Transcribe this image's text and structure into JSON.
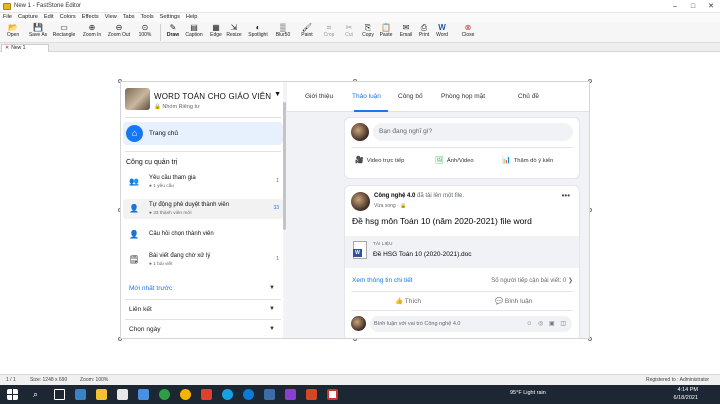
{
  "window": {
    "title": "New 1 - FastStone Editor",
    "controls": {
      "minimize": "–",
      "maximize": "□",
      "close": "✕"
    }
  },
  "menu": [
    "File",
    "Capture",
    "Edit",
    "Colors",
    "Effects",
    "View",
    "Tabs",
    "Tools",
    "Settings",
    "Help"
  ],
  "toolbar": [
    {
      "label": "Open",
      "icon": "open-folder-icon",
      "glyph": "📂"
    },
    {
      "label": "Save As",
      "icon": "save-icon",
      "glyph": "💾"
    },
    {
      "label": "Rectangle",
      "icon": "rectangle-select-icon",
      "glyph": "▭"
    },
    {
      "label": "Zoom In",
      "icon": "zoom-in-icon",
      "glyph": "⊕"
    },
    {
      "label": "Zoom Out",
      "icon": "zoom-out-icon",
      "glyph": "⊖"
    },
    {
      "label": "100%",
      "icon": "actual-size-icon",
      "glyph": "⊙"
    },
    {
      "label": "Draw",
      "icon": "draw-icon",
      "glyph": "✎"
    },
    {
      "label": "Caption",
      "icon": "caption-icon",
      "glyph": "▤"
    },
    {
      "label": "Edge",
      "icon": "edge-icon",
      "glyph": "▦"
    },
    {
      "label": "Resize",
      "icon": "resize-icon",
      "glyph": "⇲"
    },
    {
      "label": "Spotlight",
      "icon": "spotlight-icon",
      "glyph": "◐"
    },
    {
      "label": "Blur50",
      "icon": "blur-icon",
      "glyph": "▒"
    },
    {
      "label": "Paint",
      "icon": "paint-icon",
      "glyph": "🖌"
    },
    {
      "label": "Crop",
      "icon": "crop-icon",
      "glyph": "⌗"
    },
    {
      "label": "Cut",
      "icon": "cut-icon",
      "glyph": "✂"
    },
    {
      "label": "Copy",
      "icon": "copy-icon",
      "glyph": "⎘"
    },
    {
      "label": "Paste",
      "icon": "paste-icon",
      "glyph": "📋"
    },
    {
      "label": "Email",
      "icon": "email-icon",
      "glyph": "✉"
    },
    {
      "label": "Print",
      "icon": "print-icon",
      "glyph": "⎙"
    },
    {
      "label": "Word",
      "icon": "word-icon",
      "glyph": "W"
    },
    {
      "label": "Close",
      "icon": "close-icon",
      "glyph": "⊗"
    }
  ],
  "document_tab": {
    "label": "New 1",
    "close": "✕"
  },
  "facebook": {
    "group": {
      "name": "WORD TOÁN CHO GIÁO VIÊN",
      "privacy": "🔒 Nhóm Riêng tư",
      "caret": "▼"
    },
    "home": {
      "label": "Trang chủ",
      "glyph": "⌂"
    },
    "admin_title": "Công cụ quản trị",
    "tools": [
      {
        "title": "Yêu cầu tham gia",
        "sub": "● 1 yêu cầu",
        "count": "1",
        "glyph": "👥"
      },
      {
        "title": "Tự động phê duyệt thành viên",
        "sub": "● 33 thành viên mới",
        "count": "33",
        "glyph": "👤"
      },
      {
        "title": "Câu hỏi chọn thành viên",
        "sub": "",
        "count": "",
        "glyph": "👤"
      },
      {
        "title": "Bài viết đang chờ xử lý",
        "sub": "● 1 bài viết",
        "count": "1",
        "glyph": "🗒"
      }
    ],
    "sections": [
      {
        "label": "Mới nhất trước",
        "chevron": "▼"
      },
      {
        "label": "Liên kết",
        "chevron": "▼"
      },
      {
        "label": "Chọn ngày",
        "chevron": "▼"
      }
    ],
    "tabs": [
      "Giới thiệu",
      "Thảo luận",
      "Công bố",
      "Phòng họp mặt",
      "Chủ đề"
    ],
    "composer": {
      "placeholder": "Bạn đang nghĩ gì?",
      "actions": [
        {
          "label": "Video trực tiếp",
          "glyph": "🎥"
        },
        {
          "label": "Ảnh/Video",
          "glyph": "🖼"
        },
        {
          "label": "Thăm dò ý kiến",
          "glyph": "📊"
        }
      ]
    },
    "post": {
      "author": "Công nghệ 4.0",
      "action": "đã tải lên một file.",
      "time": "Vừa xong · 🔒",
      "more": "•••",
      "text": "Đề hsg môn Toán 10 (năm 2020-2021) file word",
      "attachment": {
        "kind": "TÀI LIỆU",
        "name": "Đề HSG Toán 10 (2020-2021).doc",
        "badge": "W"
      },
      "detail_link": "Xem thông tin chi tiết",
      "seen": "Số người tiếp cận bài viết: 0  ❯",
      "like": "👍 Thích",
      "comment": "💬 Bình luận",
      "comment_placeholder": "Bình luận với vai trò Công nghệ 4.0",
      "comment_icons": "☺ ◎ ▣ ◫"
    }
  },
  "statusbar": {
    "page": "1 / 1",
    "size": "Size: 1248 x 690",
    "zoom": "Zoom: 100%",
    "registered": "Registered to : Administrator"
  },
  "taskbar": {
    "weather": "95°F  Light rain",
    "time": "4:14 PM",
    "date": "6/18/2021"
  },
  "colors": {
    "accent": "#1877f2",
    "taskbar": "#1c2733"
  }
}
